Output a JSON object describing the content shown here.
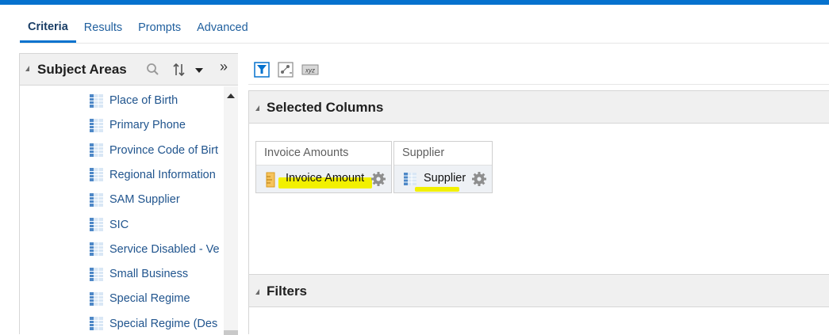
{
  "tabs": [
    {
      "label": "Criteria",
      "active": true
    },
    {
      "label": "Results",
      "active": false
    },
    {
      "label": "Prompts",
      "active": false
    },
    {
      "label": "Advanced",
      "active": false
    }
  ],
  "subject_areas": {
    "title": "Subject Areas",
    "items": [
      "Place of Birth",
      "Primary Phone",
      "Province Code of Birt",
      "Regional Information",
      "SAM Supplier",
      "SIC",
      "Service Disabled - Ve",
      "Small Business",
      "Special Regime",
      "Special Regime (Des"
    ]
  },
  "toolbar": {
    "icons": [
      "filter-icon",
      "chart-icon",
      "xyz-icon"
    ]
  },
  "selected_columns": {
    "title": "Selected Columns",
    "columns": [
      {
        "folder": "Invoice Amounts",
        "name": "Invoice Amount",
        "type": "measure"
      },
      {
        "folder": "Supplier",
        "name": "Supplier",
        "type": "attribute"
      }
    ]
  },
  "filters": {
    "title": "Filters"
  },
  "colors": {
    "accent": "#0572ce",
    "link": "#21558e",
    "highlight": "#f2f000"
  }
}
